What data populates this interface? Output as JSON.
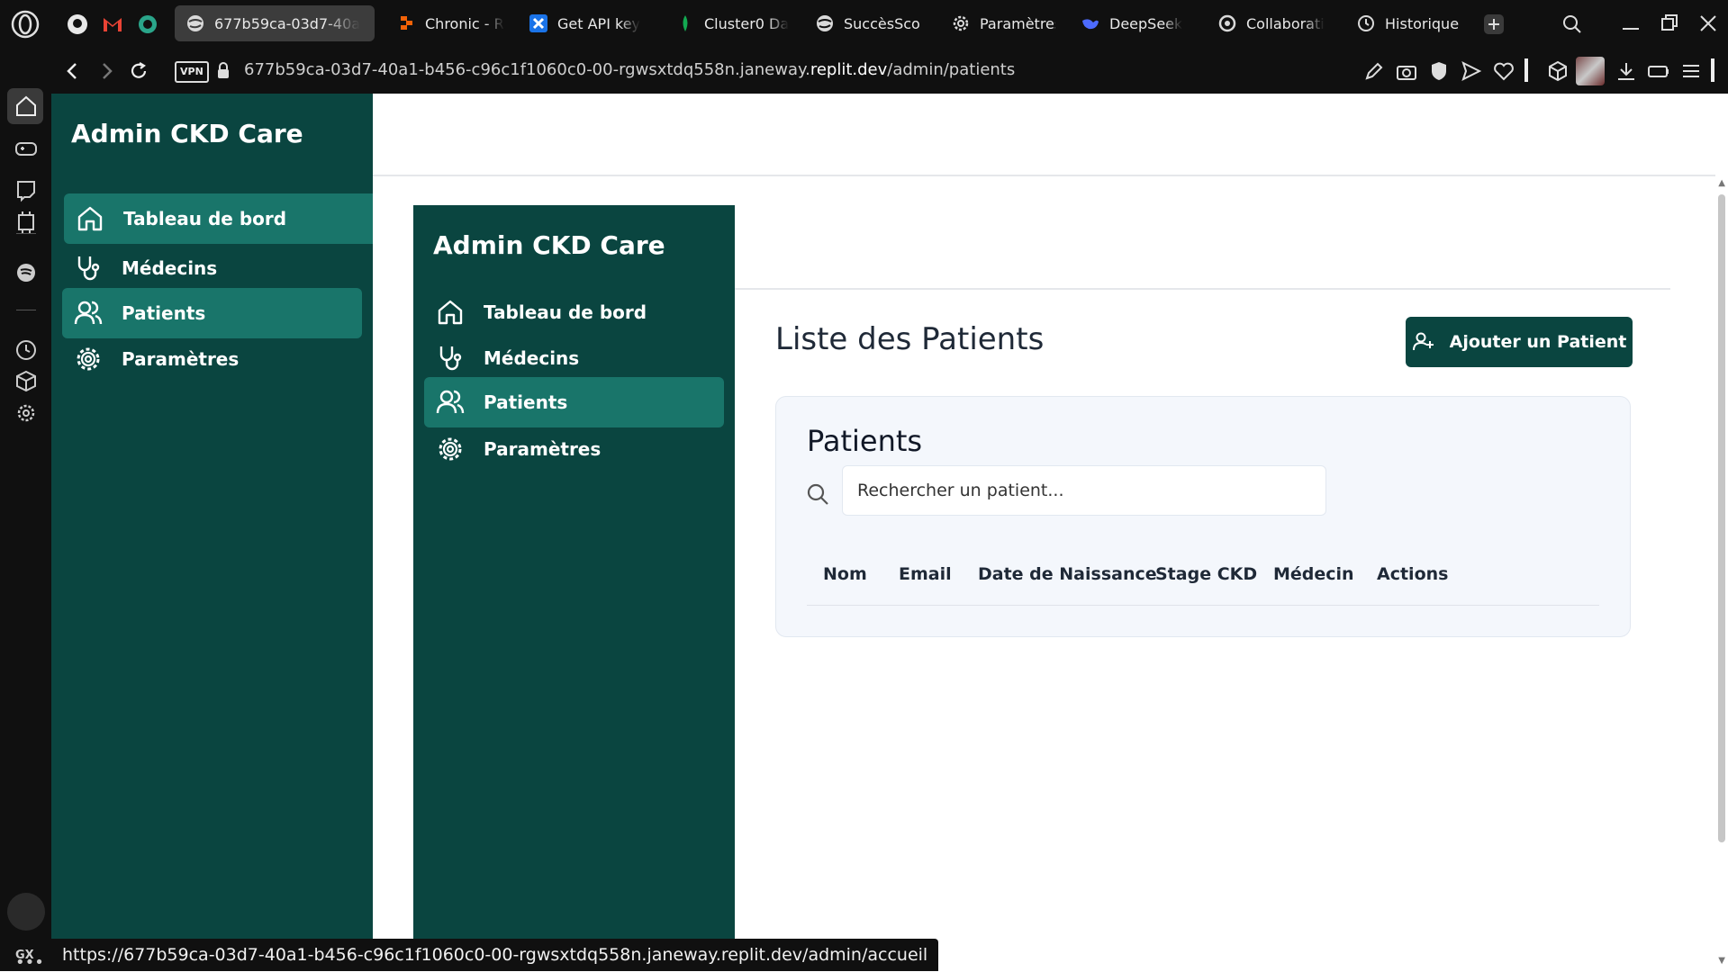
{
  "browser": {
    "tabs": [
      {
        "label": "677b59ca-03d7-40a",
        "icon": "globe-icon",
        "active": true
      },
      {
        "label": "Chronic - R",
        "icon": "replit-icon"
      },
      {
        "label": "Get API key",
        "icon": "gemini-icon"
      },
      {
        "label": "Cluster0 Da",
        "icon": "mongodb-leaf-icon"
      },
      {
        "label": "SuccèsSco",
        "icon": "globe-icon"
      },
      {
        "label": "Paramètres",
        "icon": "gear-icon"
      },
      {
        "label": "DeepSeek",
        "icon": "deepseek-icon"
      },
      {
        "label": "Collaborati",
        "icon": "openai-icon"
      },
      {
        "label": "Historique",
        "icon": "clock-icon"
      }
    ],
    "vpn_label": "VPN",
    "url_prefix": "677b59ca-03d7-40a1-b456-c96c1f1060c0-00-rgwsxtdq558n.janeway.",
    "url_domain": "replit.dev",
    "url_path": "/admin/patients",
    "status_url": "https://677b59ca-03d7-40a1-b456-c96c1f1060c0-00-rgwsxtdq558n.janeway.replit.dev/admin/accueil",
    "rail_gx": "GX"
  },
  "app": {
    "brand": "Admin CKD Care",
    "nav": [
      {
        "label": "Tableau de bord",
        "icon": "home-icon"
      },
      {
        "label": "Médecins",
        "icon": "stethoscope-icon"
      },
      {
        "label": "Patients",
        "icon": "users-icon",
        "active": true
      },
      {
        "label": "Paramètres",
        "icon": "gear-icon"
      }
    ],
    "page_title": "Liste des Patients",
    "add_button": "Ajouter un Patient",
    "card_title": "Patients",
    "search_placeholder": "Rechercher un patient...",
    "table_headers": [
      "Nom",
      "Email",
      "Date de Naissance",
      "Stage CKD",
      "Médecin",
      "Actions"
    ],
    "colors": {
      "sidebar": "#0a4540",
      "active": "#19756a",
      "card": "#f4f7fc"
    }
  }
}
